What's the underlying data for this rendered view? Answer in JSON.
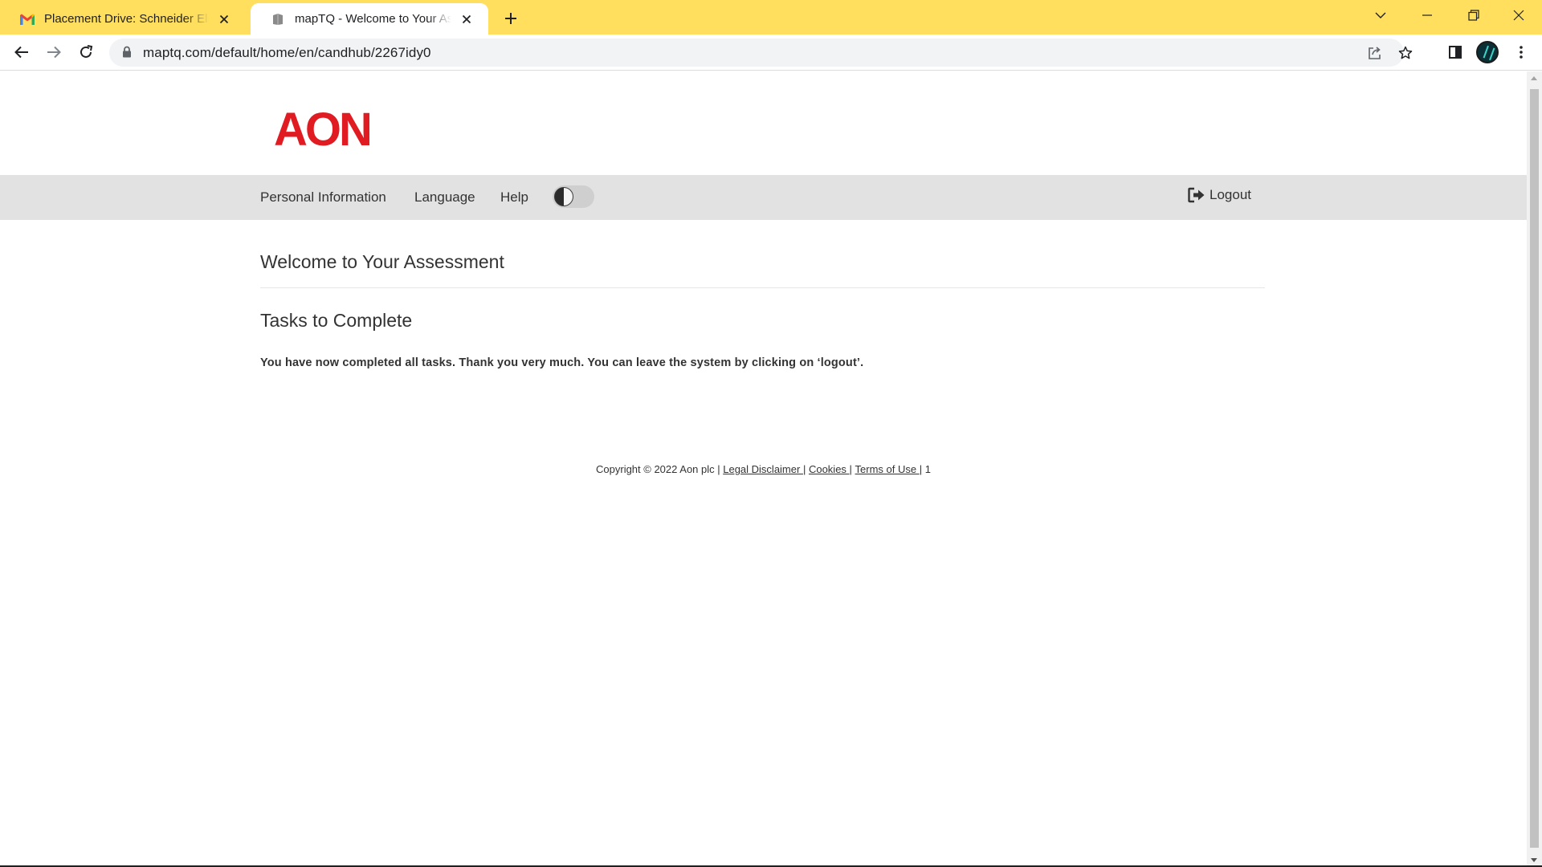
{
  "browser": {
    "tabs": [
      {
        "title": "Placement Drive: Schneider Electric",
        "icon": "gmail-icon",
        "active": false
      },
      {
        "title": "mapTQ - Welcome to Your Assessment",
        "icon": "page-icon",
        "active": true
      }
    ],
    "address": "maptq.com/default/home/en/candhub/2267idy0"
  },
  "site": {
    "logo_text": "AON",
    "brand_color": "#e11b22",
    "nav": {
      "personal_information": "Personal Information",
      "language": "Language",
      "help": "Help",
      "logout": "Logout"
    }
  },
  "main": {
    "title": "Welcome to Your Assessment",
    "subtitle": "Tasks to Complete",
    "message": "You have now completed all tasks. Thank you very much. You can leave the system by clicking on ‘logout’."
  },
  "footer": {
    "copyright": "Copyright © 2022 Aon plc | ",
    "legal": "Legal Disclaimer ",
    "cookies": "Cookies ",
    "terms": "Terms of Use ",
    "sep": "|",
    "page_number": "1"
  }
}
